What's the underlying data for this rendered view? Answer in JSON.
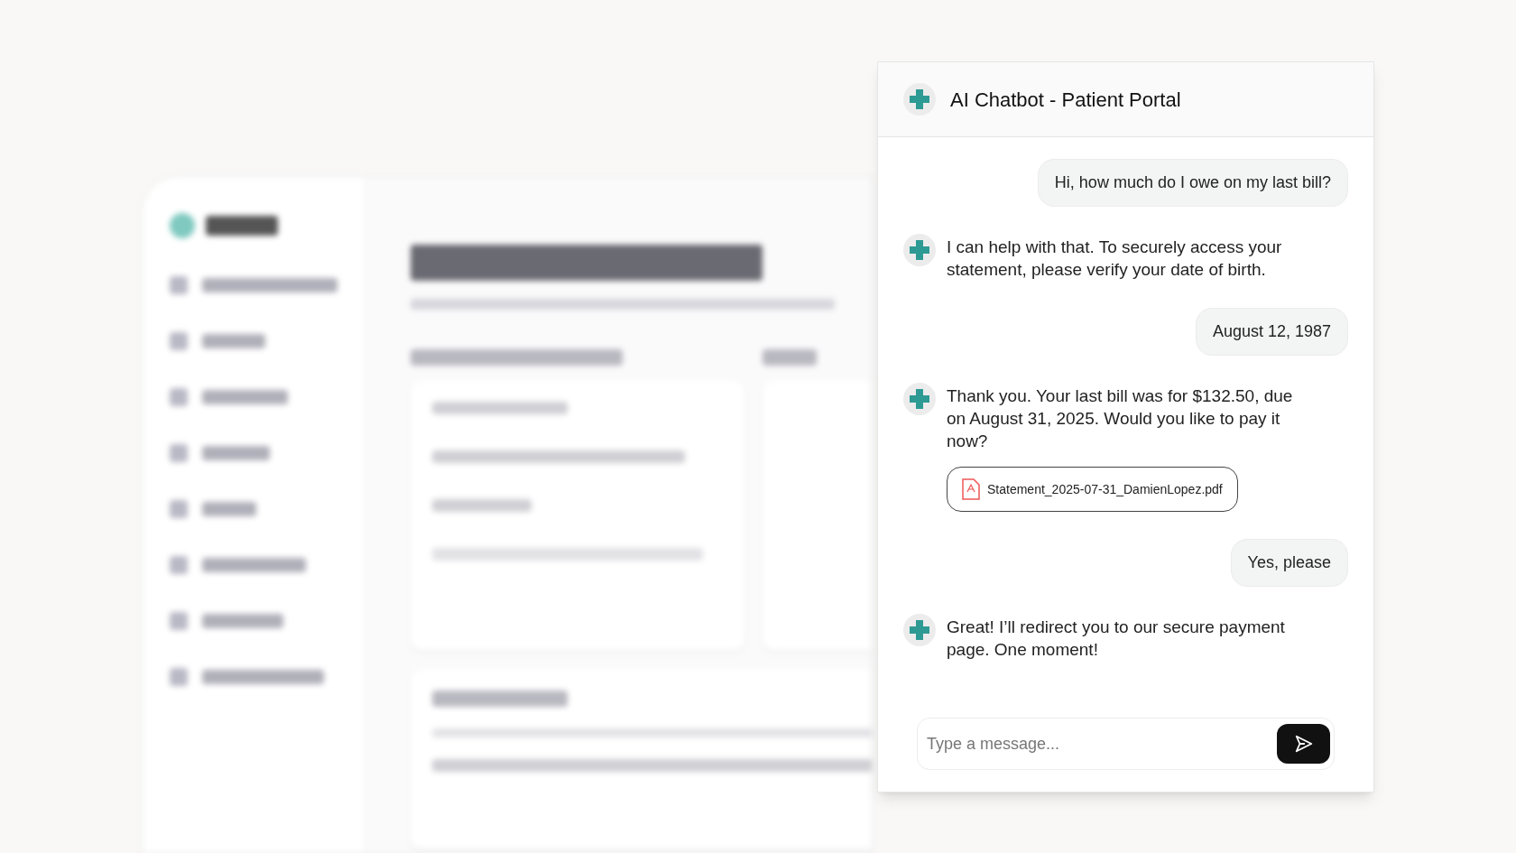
{
  "chat": {
    "title": "AI Chatbot - Patient Portal",
    "messages": [
      {
        "kind": "user",
        "text": "Hi, how much do I owe on my last bill?"
      },
      {
        "kind": "bot",
        "text": "I can help with that. To securely access your statement, please verify your date of birth."
      },
      {
        "kind": "user",
        "text": "August 12, 1987"
      },
      {
        "kind": "bot",
        "text": "Thank you. Your last bill was for $132.50, due on August 31, 2025. Would you like to pay it now?",
        "attachment": "Statement_2025-07-31_DamienLopez.pdf"
      },
      {
        "kind": "user",
        "text": "Yes, please"
      },
      {
        "kind": "bot",
        "text": "Great! I’ll redirect you to our secure payment page. One moment!"
      }
    ],
    "input": {
      "placeholder": "Type a message..."
    }
  }
}
